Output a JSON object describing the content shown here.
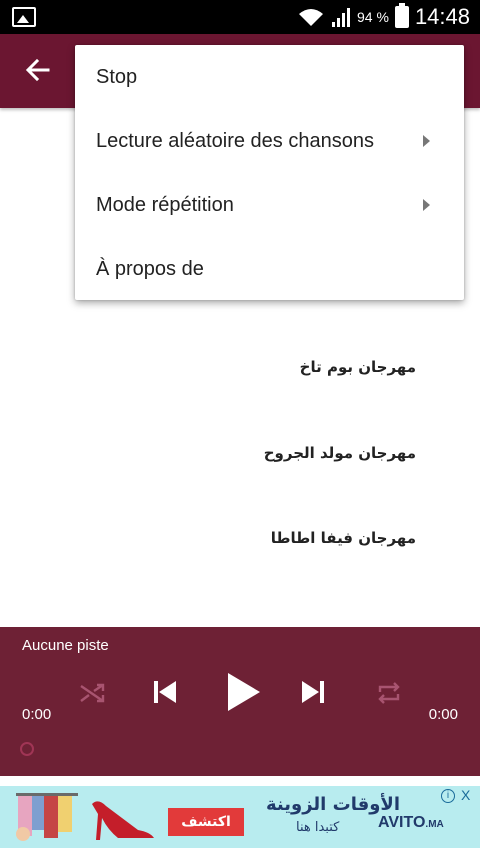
{
  "status_bar": {
    "battery_percent": "94 %",
    "time": "14:48"
  },
  "menu": {
    "items": [
      {
        "label": "Stop"
      },
      {
        "label": "Lecture aléatoire des chansons"
      },
      {
        "label": "Mode répétition"
      },
      {
        "label": "À propos de"
      }
    ]
  },
  "tracks": [
    {
      "title": "مهرجان بوم تاخ"
    },
    {
      "title": "مهرجان مولد الجروح"
    },
    {
      "title": "مهرجان فيفا اطاطا"
    }
  ],
  "player": {
    "now_playing": "Aucune piste",
    "elapsed": "0:00",
    "duration": "0:00",
    "progress": 0
  },
  "ad": {
    "headline": "الأوقات الزوينة",
    "sub": "كتبدا هنا",
    "cta": "اكتشف",
    "brand": "AVITO",
    "brand_suffix": ".MA",
    "info": "i",
    "close": "X"
  },
  "colors": {
    "app_bar": "#6b1631",
    "player": "#6e2135",
    "ad_bg": "#b8ecef",
    "ad_button": "#e23a3a"
  }
}
